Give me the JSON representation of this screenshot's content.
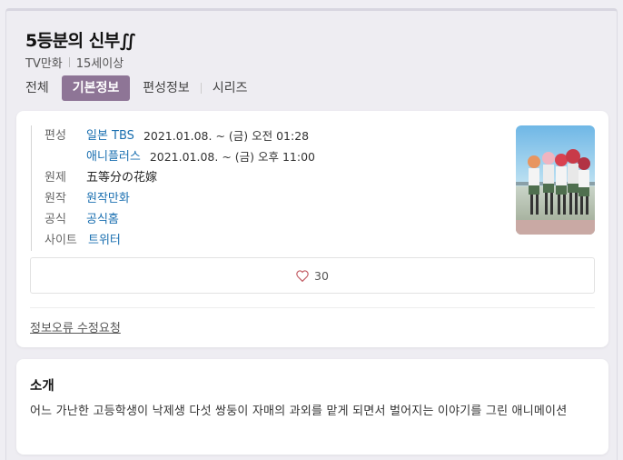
{
  "header": {
    "title": "5등분의 신부∬",
    "type": "TV만화",
    "rating": "15세이상"
  },
  "tabs": [
    {
      "label": "전체",
      "active": false
    },
    {
      "label": "기본정보",
      "active": true
    },
    {
      "label": "편성정보",
      "active": false
    },
    {
      "label": "시리즈",
      "active": false
    }
  ],
  "info": {
    "broadcast_label": "편성",
    "broadcasts": [
      {
        "channel": "일본 TBS",
        "time": "2021.01.08. ~ (금) 오전 01:28"
      },
      {
        "channel": "애니플러스",
        "time": "2021.01.08. ~ (금) 오후 11:00"
      }
    ],
    "original_title_label": "원제",
    "original_title": "五等分の花嫁",
    "source_label": "원작",
    "source": "원작만화",
    "official_label": "공식",
    "official": "공식홈",
    "site_label": "사이트",
    "site": "트위터"
  },
  "like": {
    "count": "30",
    "icon": "heart-outline-icon",
    "color": "#c0575f"
  },
  "report_label": "정보오류 수정요청",
  "intro": {
    "heading": "소개",
    "text": "어느 가난한 고등학생이 낙제생 다섯 쌍둥이 자매의 과외를 맡게 되면서 벌어지는 이야기를 그린 애니메이션"
  },
  "colors": {
    "accent": "#8e7596",
    "link": "#1a6fb0"
  }
}
